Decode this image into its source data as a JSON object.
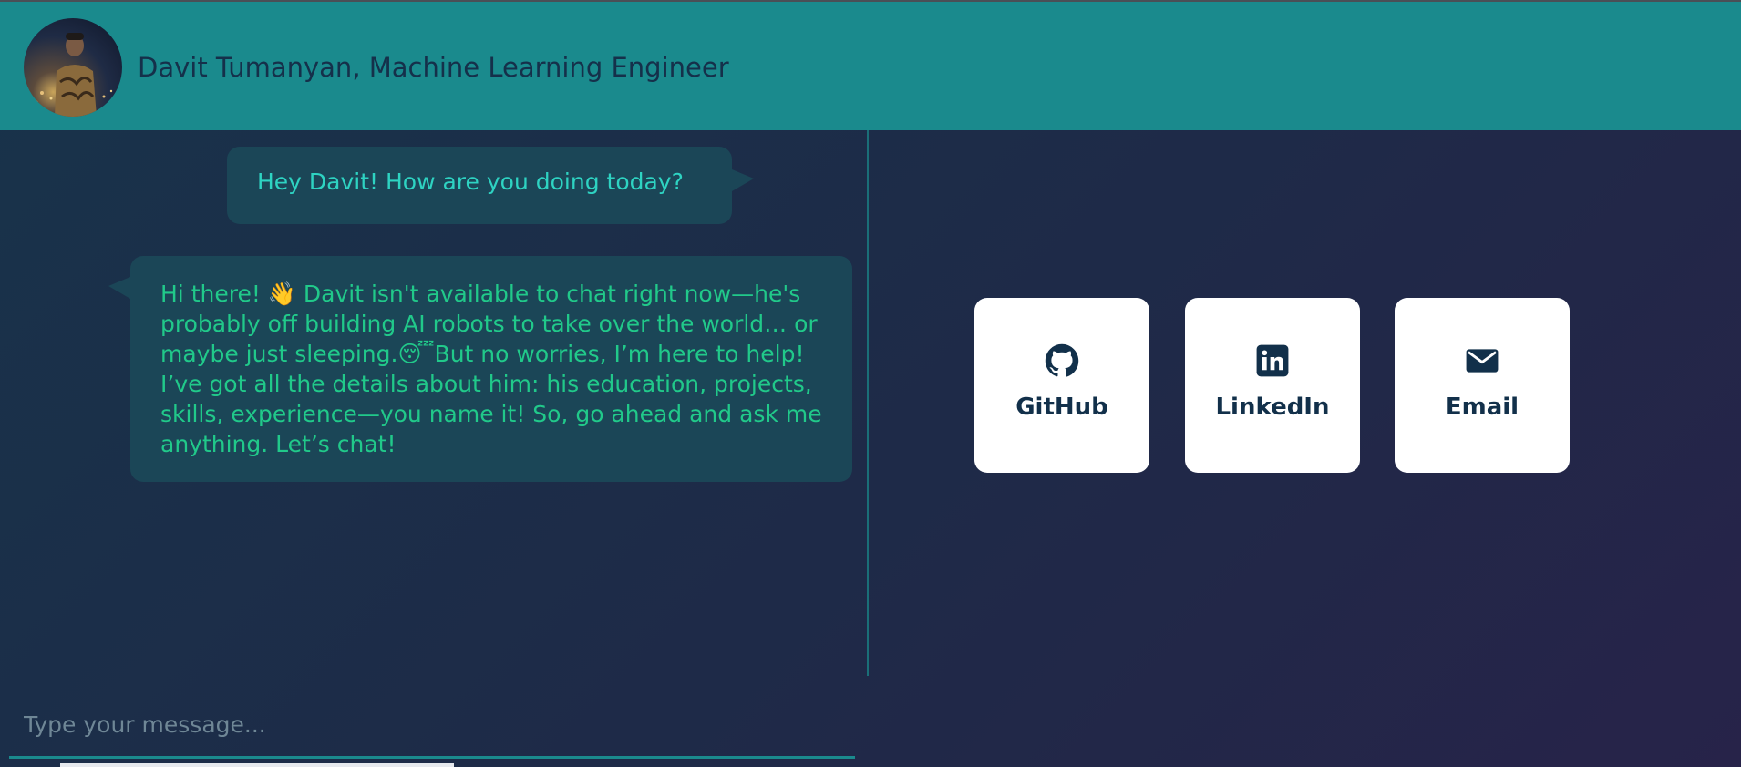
{
  "header": {
    "title": "Davit Tumanyan, Machine Learning Engineer",
    "avatar_icon": "profile-photo"
  },
  "chat": {
    "messages": [
      {
        "sender": "user",
        "text": "Hey Davit! How are you doing today?"
      },
      {
        "sender": "bot",
        "text_part1": "Hi there! ",
        "emoji1": "👋",
        "text_part2": " Davit isn't available to chat right now—he's probably off building AI robots to take over the world… or maybe just sleeping.",
        "emoji2": "😴",
        "text_part3": "But no worries, I’m here to help! I’ve got all the details about him: his education, projects, skills, experience—you name it! So, go ahead and ask me anything. Let’s chat!"
      }
    ],
    "input": {
      "placeholder": "Type your message..."
    }
  },
  "links": [
    {
      "label": "GitHub",
      "icon": "github-icon"
    },
    {
      "label": "LinkedIn",
      "icon": "linkedin-icon"
    },
    {
      "label": "Email",
      "icon": "envelope-icon"
    }
  ],
  "colors": {
    "header": "#1a8a8d",
    "title": "#15304a",
    "user_text": "#2ed3c2",
    "bot_text": "#21c98a",
    "bubble": "#1b4657",
    "card": "#ffffff",
    "card_label": "#12304a"
  }
}
